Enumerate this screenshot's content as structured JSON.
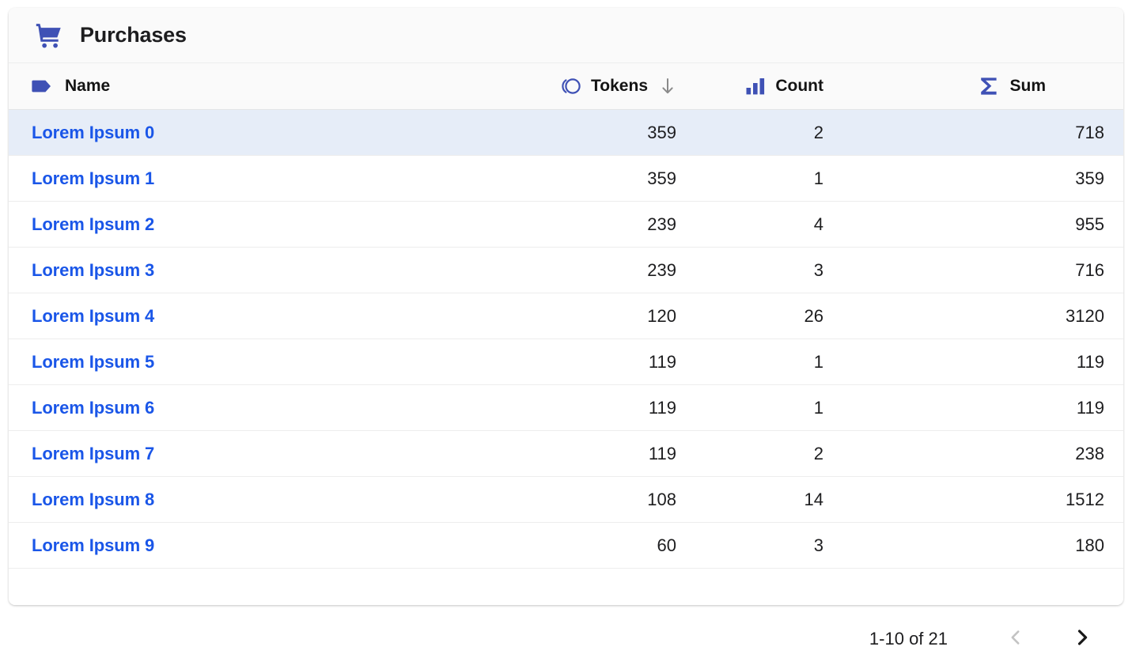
{
  "card": {
    "title": "Purchases",
    "title_icon": "shopping-cart-icon"
  },
  "table": {
    "columns": [
      {
        "key": "name",
        "label": "Name",
        "icon": "tag-icon",
        "align": "left",
        "sorted": false
      },
      {
        "key": "tokens",
        "label": "Tokens",
        "icon": "token-icon",
        "align": "right",
        "sorted": true,
        "sort_direction": "desc",
        "sort_glyph": "↓"
      },
      {
        "key": "count",
        "label": "Count",
        "icon": "bar-chart-icon",
        "align": "right",
        "sorted": false
      },
      {
        "key": "sum",
        "label": "Sum",
        "icon": "sigma-icon",
        "align": "right",
        "sorted": false
      }
    ],
    "rows": [
      {
        "name": "Lorem Ipsum 0",
        "tokens": "359",
        "count": "2",
        "sum": "718",
        "selected": true
      },
      {
        "name": "Lorem Ipsum 1",
        "tokens": "359",
        "count": "1",
        "sum": "359",
        "selected": false
      },
      {
        "name": "Lorem Ipsum 2",
        "tokens": "239",
        "count": "4",
        "sum": "955",
        "selected": false
      },
      {
        "name": "Lorem Ipsum 3",
        "tokens": "239",
        "count": "3",
        "sum": "716",
        "selected": false
      },
      {
        "name": "Lorem Ipsum 4",
        "tokens": "120",
        "count": "26",
        "sum": "3120",
        "selected": false
      },
      {
        "name": "Lorem Ipsum 5",
        "tokens": "119",
        "count": "1",
        "sum": "119",
        "selected": false
      },
      {
        "name": "Lorem Ipsum 6",
        "tokens": "119",
        "count": "1",
        "sum": "119",
        "selected": false
      },
      {
        "name": "Lorem Ipsum 7",
        "tokens": "119",
        "count": "2",
        "sum": "238",
        "selected": false
      },
      {
        "name": "Lorem Ipsum 8",
        "tokens": "108",
        "count": "14",
        "sum": "1512",
        "selected": false
      },
      {
        "name": "Lorem Ipsum 9",
        "tokens": "60",
        "count": "3",
        "sum": "180",
        "selected": false
      }
    ]
  },
  "pagination": {
    "range_label": "1-10 of 21",
    "prev_icon": "chevron-left-icon",
    "next_icon": "chevron-right-icon",
    "prev_enabled": false,
    "next_enabled": true
  },
  "colors": {
    "accent_blue": "#3f51b5",
    "link_blue": "#1a56e8",
    "selected_row_bg": "#e6edf8",
    "header_bg": "#fafafa",
    "text": "#1d1d1f",
    "divider": "#ededed",
    "disabled_gray": "#bdbdbd"
  }
}
